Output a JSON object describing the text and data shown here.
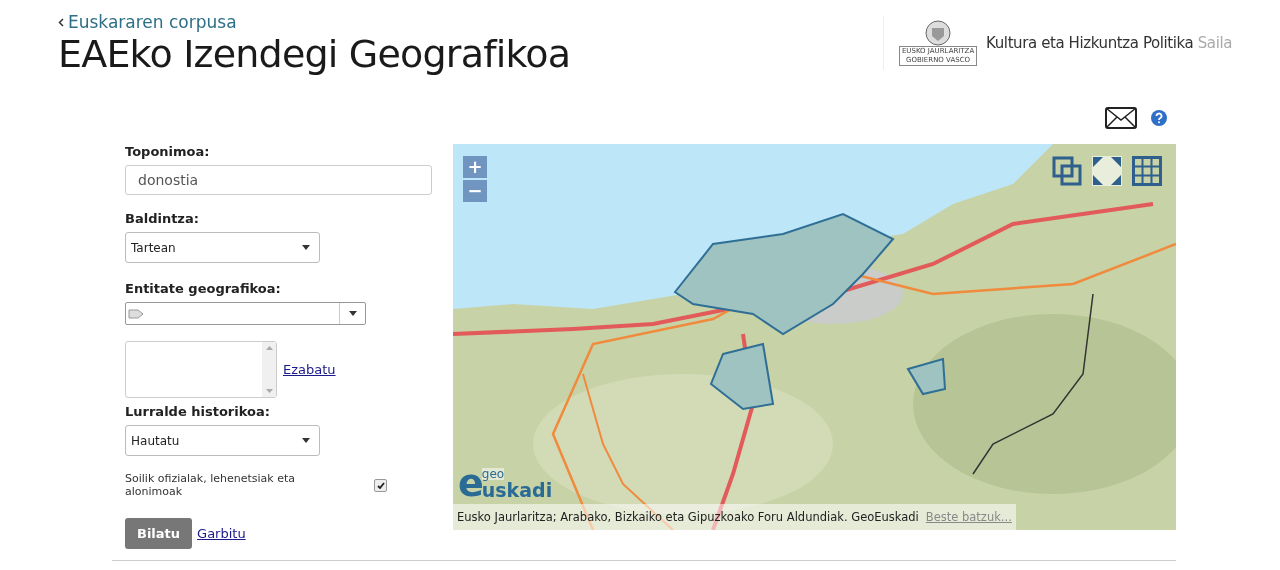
{
  "header": {
    "back_link": "Euskararen corpusa",
    "title": "EAEko Izendegi Geografikoa",
    "logo_lines": [
      "EUSKO JAURLARITZA",
      "GOBIERNO VASCO"
    ],
    "department": "Kultura eta Hizkuntza Politika",
    "department_suffix": "Saila"
  },
  "form": {
    "toponym": {
      "label": "Toponimoa:",
      "value": "donostia"
    },
    "condition": {
      "label": "Baldintza:",
      "value": "Tartean"
    },
    "entity": {
      "label": "Entitate geografikoa:"
    },
    "entity_list": {
      "link": "Ezabatu"
    },
    "territory": {
      "label": "Lurralde historikoa:",
      "value": "Hautatu"
    },
    "only_official": {
      "label": "Soilik ofizialak, lehenetsiak eta alonimoak",
      "checked": true
    },
    "search_button": "Bilatu",
    "clear_link": "Garbitu"
  },
  "map": {
    "zoom_in": "+",
    "zoom_out": "−",
    "logo": {
      "small": "geo",
      "initial": "e",
      "rest": "uskadi"
    },
    "attribution": "Eusko Jaurlaritza; Arabako, Bizkaiko eta Gipuzkoako Foru Aldundiak. GeoEuskadi",
    "more_link": "Beste batzuk..."
  }
}
